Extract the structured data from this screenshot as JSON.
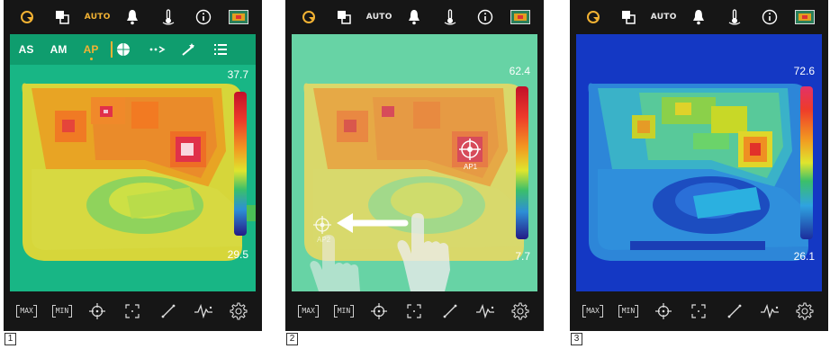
{
  "panels": [
    {
      "number": "1",
      "scale_max": "37.7",
      "scale_min": "29.5",
      "palette": "iron",
      "background": "#18b685"
    },
    {
      "number": "2",
      "scale_max": "62.4",
      "scale_min": "7.7",
      "palette": "iron",
      "background": "#67d3a5",
      "ap_label": "AP1",
      "ap2_label": "AP2"
    },
    {
      "number": "3",
      "scale_max": "72.6",
      "scale_min": "26.1",
      "palette": "rainbow",
      "background": "#1438c4"
    }
  ],
  "topbar": {
    "capture_icon": "capture-icon",
    "window_icon": "window-icon",
    "auto_label": "AUTO",
    "alarm_icon": "alarm-icon",
    "thermometer_icon": "thermometer-icon",
    "info_icon": "info-icon",
    "palette_icon": "palette-icon"
  },
  "modebar": {
    "as": "AS",
    "am": "AM",
    "ap": "AP",
    "circle_icon": "circle-icon",
    "more_icon": "more-icon",
    "wand_icon": "wand-icon",
    "list_icon": "list-icon"
  },
  "bottombar": {
    "max_label": "MAX",
    "min_label": "MIN",
    "crosshair_icon": "crosshair-icon",
    "region_icon": "region-icon",
    "line_icon": "line-icon",
    "graph_icon": "graph-icon",
    "settings_icon": "settings-icon"
  },
  "colors": {
    "accent": "#f2b233",
    "bar_bg": "#161616",
    "modebar_bg": "#0f9d6e"
  }
}
